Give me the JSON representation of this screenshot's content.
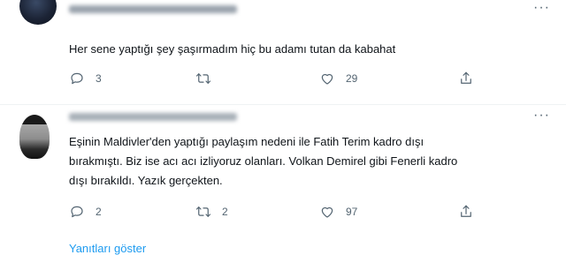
{
  "tweets": [
    {
      "text": "Her sene yaptığı şey şaşırmadım hiç bu adamı tutan da kabahat",
      "replies": "3",
      "retweets": "",
      "likes": "29",
      "icons": [
        "reply-icon",
        "retweet-icon",
        "like-icon",
        "share-icon"
      ]
    },
    {
      "text": "Eşinin Maldivler'den yaptığı paylaşım nedeni ile Fatih Terim kadro dışı\nbırakmıştı. Biz ise acı acı izliyoruz olanları. Volkan Demirel gibi Fenerli kadro\ndışı bırakıldı. Yazık gerçekten.",
      "replies": "2",
      "retweets": "2",
      "likes": "97",
      "icons": [
        "reply-icon",
        "retweet-icon",
        "like-icon",
        "share-icon"
      ]
    }
  ],
  "more_label": "···",
  "show_replies": "Yanıtları göster",
  "colors": {
    "accent": "#1d9bf0",
    "muted": "#536471",
    "text": "#0f1419"
  }
}
